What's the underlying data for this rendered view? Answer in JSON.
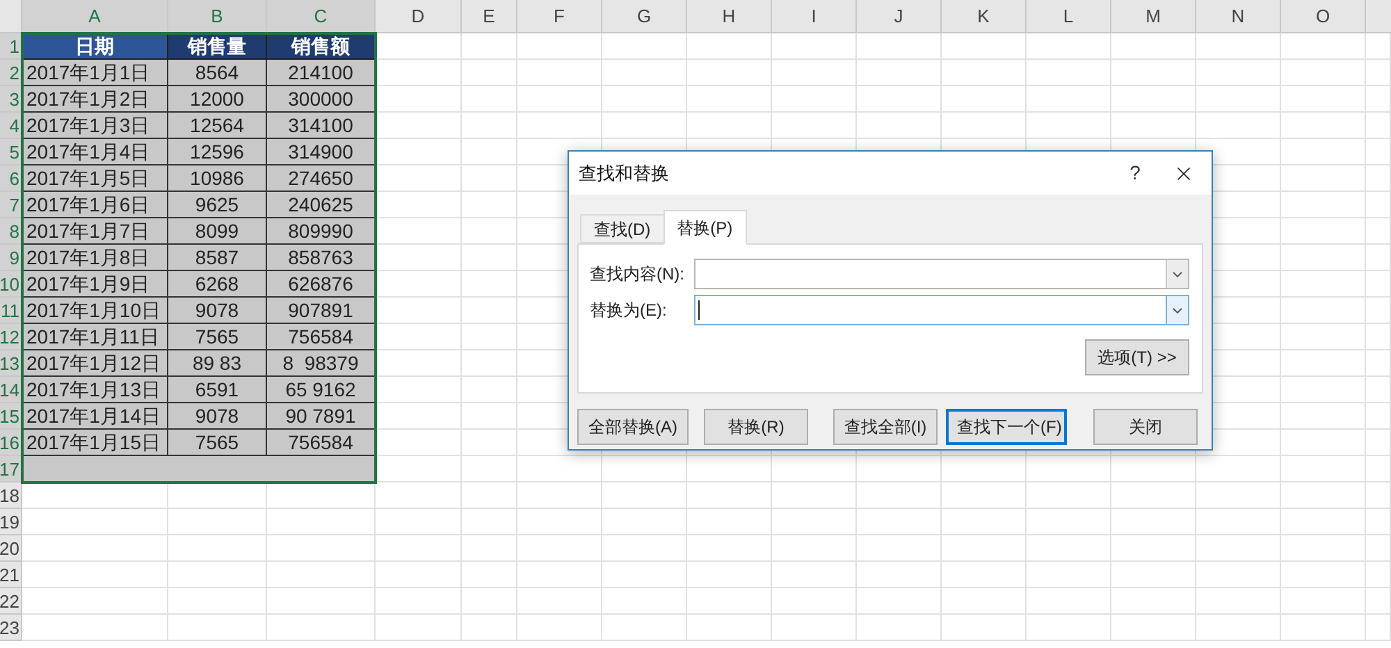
{
  "sheet": {
    "column_headers": [
      {
        "label": "A",
        "selected": true
      },
      {
        "label": "B",
        "selected": true
      },
      {
        "label": "C",
        "selected": true
      },
      {
        "label": "D",
        "selected": false
      },
      {
        "label": "E",
        "selected": false
      },
      {
        "label": "F",
        "selected": false
      },
      {
        "label": "G",
        "selected": false
      },
      {
        "label": "H",
        "selected": false
      },
      {
        "label": "I",
        "selected": false
      },
      {
        "label": "J",
        "selected": false
      },
      {
        "label": "K",
        "selected": false
      },
      {
        "label": "L",
        "selected": false
      },
      {
        "label": "M",
        "selected": false
      },
      {
        "label": "N",
        "selected": false
      },
      {
        "label": "O",
        "selected": false
      }
    ],
    "row_headers": [
      {
        "label": "1",
        "selected": true
      },
      {
        "label": "2",
        "selected": true
      },
      {
        "label": "3",
        "selected": true
      },
      {
        "label": "4",
        "selected": true
      },
      {
        "label": "5",
        "selected": true
      },
      {
        "label": "6",
        "selected": true
      },
      {
        "label": "7",
        "selected": true
      },
      {
        "label": "8",
        "selected": true
      },
      {
        "label": "9",
        "selected": true
      },
      {
        "label": "10",
        "selected": true
      },
      {
        "label": "11",
        "selected": true
      },
      {
        "label": "12",
        "selected": true
      },
      {
        "label": "13",
        "selected": true
      },
      {
        "label": "14",
        "selected": true
      },
      {
        "label": "15",
        "selected": true
      },
      {
        "label": "16",
        "selected": true
      },
      {
        "label": "17",
        "selected": true
      },
      {
        "label": "18",
        "selected": false
      },
      {
        "label": "19",
        "selected": false
      },
      {
        "label": "20",
        "selected": false
      },
      {
        "label": "21",
        "selected": false
      },
      {
        "label": "22",
        "selected": false
      },
      {
        "label": "23",
        "selected": false
      }
    ],
    "table": {
      "header": [
        "日期",
        "销售量",
        "销售额"
      ],
      "rows": [
        [
          "2017年1月1日",
          "8564",
          "214100"
        ],
        [
          "2017年1月2日",
          "12000",
          "300000"
        ],
        [
          "2017年1月3日",
          "12564",
          "314100"
        ],
        [
          "2017年1月4日",
          "12596",
          "314900"
        ],
        [
          "2017年1月5日",
          "10986",
          "274650"
        ],
        [
          "2017年1月6日",
          "9625",
          "240625"
        ],
        [
          "2017年1月7日",
          "8099",
          "809990"
        ],
        [
          "2017年1月8日",
          "8587",
          "858763"
        ],
        [
          "2017年1月9日",
          "6268",
          "626876"
        ],
        [
          "2017年1月10日",
          "9078",
          "907891"
        ],
        [
          "2017年1月11日",
          "7565",
          "756584"
        ],
        [
          "2017年1月12日",
          "89 83",
          "8  98379"
        ],
        [
          "2017年1月13日",
          "6591",
          "65 9162"
        ],
        [
          "2017年1月14日",
          "9078",
          "90 7891"
        ],
        [
          "2017年1月15日",
          "7565",
          "756584"
        ]
      ]
    }
  },
  "dialog": {
    "title": "查找和替换",
    "help": "?",
    "tabs": [
      {
        "label": "查找(D)",
        "selected": false
      },
      {
        "label": "替换(P)",
        "selected": true
      }
    ],
    "fields": [
      {
        "label": "查找内容(N):",
        "focused": false
      },
      {
        "label": "替换为(E):",
        "focused": true
      }
    ],
    "options_button": "选项(T) >>",
    "buttons": [
      {
        "label": "全部替换(A)",
        "default": false
      },
      {
        "label": "替换(R)",
        "default": false
      },
      {
        "label": "查找全部(I)",
        "default": false
      },
      {
        "label": "查找下一个(F)",
        "default": true
      },
      {
        "label": "关闭",
        "default": false
      }
    ]
  }
}
